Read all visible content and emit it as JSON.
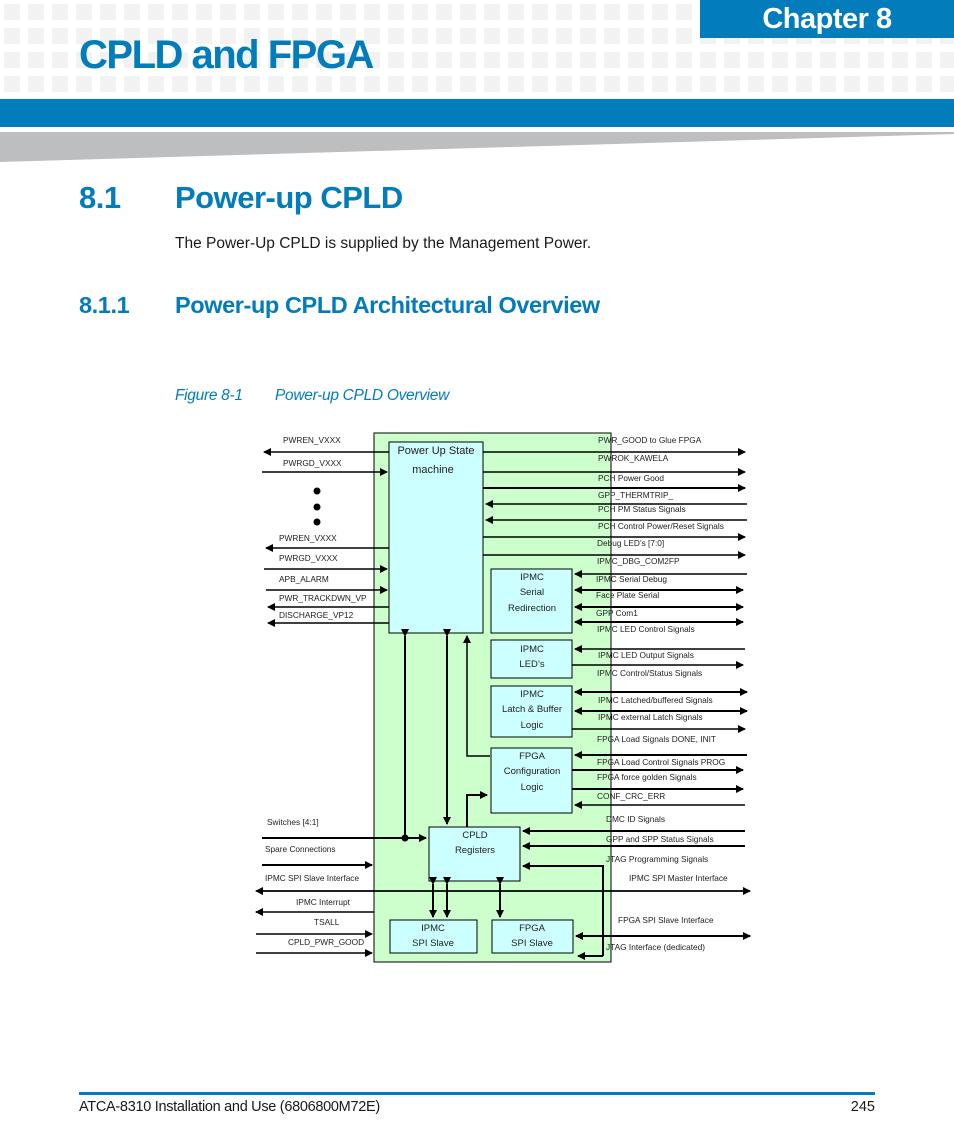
{
  "header": {
    "chapter_label": "Chapter 8",
    "chapter_title": "CPLD and FPGA",
    "colors": {
      "brand_blue": "#027cbb",
      "pattern_grey": "#f2f2f2",
      "wedge_grey": "#bdbec0"
    }
  },
  "section": {
    "number": "8.1",
    "title": "Power-up CPLD",
    "body": "The Power-Up CPLD is supplied by the Management Power."
  },
  "subsection": {
    "number": "8.1.1",
    "title": "Power-up CPLD Architectural Overview"
  },
  "figure": {
    "label": "Figure 8-1",
    "caption": "Power-up CPLD Overview",
    "colors": {
      "cpld_fill": "#ccffcc",
      "block_fill": "#ccffff",
      "line": "#000000"
    },
    "blocks": {
      "power_up_sm": [
        "Power Up State",
        "machine"
      ],
      "ipmc_serial": [
        "IPMC",
        "Serial",
        "Redirection"
      ],
      "ipmc_leds": [
        "IPMC",
        "LED’s"
      ],
      "ipmc_latch": [
        "IPMC",
        "Latch & Buffer",
        "Logic"
      ],
      "fpga_config": [
        "FPGA",
        "Configuration",
        "Logic"
      ],
      "cpld_registers": [
        "CPLD",
        "Registers"
      ],
      "ipmc_spi_slave": [
        "IPMC",
        "SPI Slave"
      ],
      "fpga_spi_slave": [
        "FPGA",
        "SPI Slave"
      ]
    },
    "left_signals": [
      "PWREN_VXXX",
      "PWRGD_VXXX",
      "PWREN_VXXX",
      "PWRGD_VXXX",
      "APB_ALARM",
      "PWR_TRACKDWN_VP",
      "DISCHARGE_VP12",
      "Switches [4:1]",
      "Spare Connections",
      "IPMC SPI Slave Interface",
      "IPMC Interrupt",
      "TSALL",
      "CPLD_PWR_GOOD"
    ],
    "right_signals": [
      "PWR_GOOD to Glue FPGA",
      "PWROK_KAWELA",
      "PCH Power Good",
      "GPP_THERMTRIP_",
      "PCH PM Status Signals",
      "PCH Control Power/Reset Signals",
      "Debug LED’s [7:0]",
      "IPMC_DBG_COM2FP",
      "IPMC Serial Debug",
      "Face Plate Serial",
      "GPP Com1",
      "IPMC LED Control Signals",
      "IPMC LED Output Signals",
      "IPMC Control/Status Signals",
      "IPMC Latched/buffered Signals",
      "IPMC external Latch Signals",
      "FPGA Load Signals DONE, INIT",
      "FPGA Load Control Signals PROG",
      "FPGA force golden Signals",
      "CONF_CRC_ERR",
      "DMC ID Signals",
      "GPP and SPP Status Signals",
      "JTAG Programming Signals",
      "IPMC SPI Master Interface",
      "FPGA SPI Slave Interface",
      "JTAG Interface (dedicated)"
    ]
  },
  "footer": {
    "document": "ATCA-8310 Installation and Use (6806800M72E)",
    "page_number": "245"
  }
}
